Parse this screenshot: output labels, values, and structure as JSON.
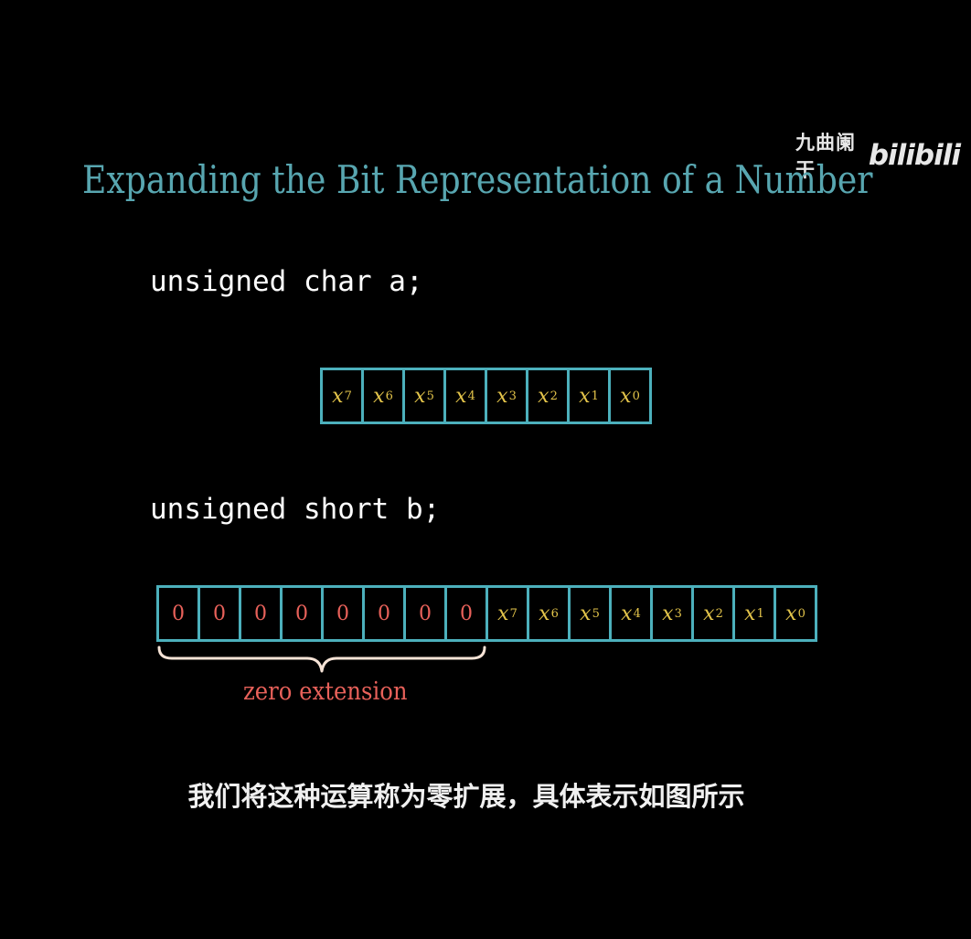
{
  "watermark": {
    "channel": "九曲阑干",
    "logo": "bilibili"
  },
  "slide": {
    "title": "Expanding the Bit Representation of a Number",
    "code_a": "unsigned char a;",
    "code_b": "unsigned short b;",
    "bits_a": [
      {
        "var": "x",
        "sub": "7"
      },
      {
        "var": "x",
        "sub": "6"
      },
      {
        "var": "x",
        "sub": "5"
      },
      {
        "var": "x",
        "sub": "4"
      },
      {
        "var": "x",
        "sub": "3"
      },
      {
        "var": "x",
        "sub": "2"
      },
      {
        "var": "x",
        "sub": "1"
      },
      {
        "var": "x",
        "sub": "0"
      }
    ],
    "bits_b_zeros": [
      "0",
      "0",
      "0",
      "0",
      "0",
      "0",
      "0",
      "0"
    ],
    "bits_b": [
      {
        "var": "x",
        "sub": "7"
      },
      {
        "var": "x",
        "sub": "6"
      },
      {
        "var": "x",
        "sub": "5"
      },
      {
        "var": "x",
        "sub": "4"
      },
      {
        "var": "x",
        "sub": "3"
      },
      {
        "var": "x",
        "sub": "2"
      },
      {
        "var": "x",
        "sub": "1"
      },
      {
        "var": "x",
        "sub": "0"
      }
    ],
    "brace_label": "zero extension"
  },
  "caption": "我们将这种运算称为零扩展，具体表示如图所示",
  "colors": {
    "title": "#58a6b0",
    "cell_border": "#4cb0bc",
    "bit_var": "#e3c44a",
    "zero": "#e8615a",
    "brace": "#f6e3d6"
  }
}
